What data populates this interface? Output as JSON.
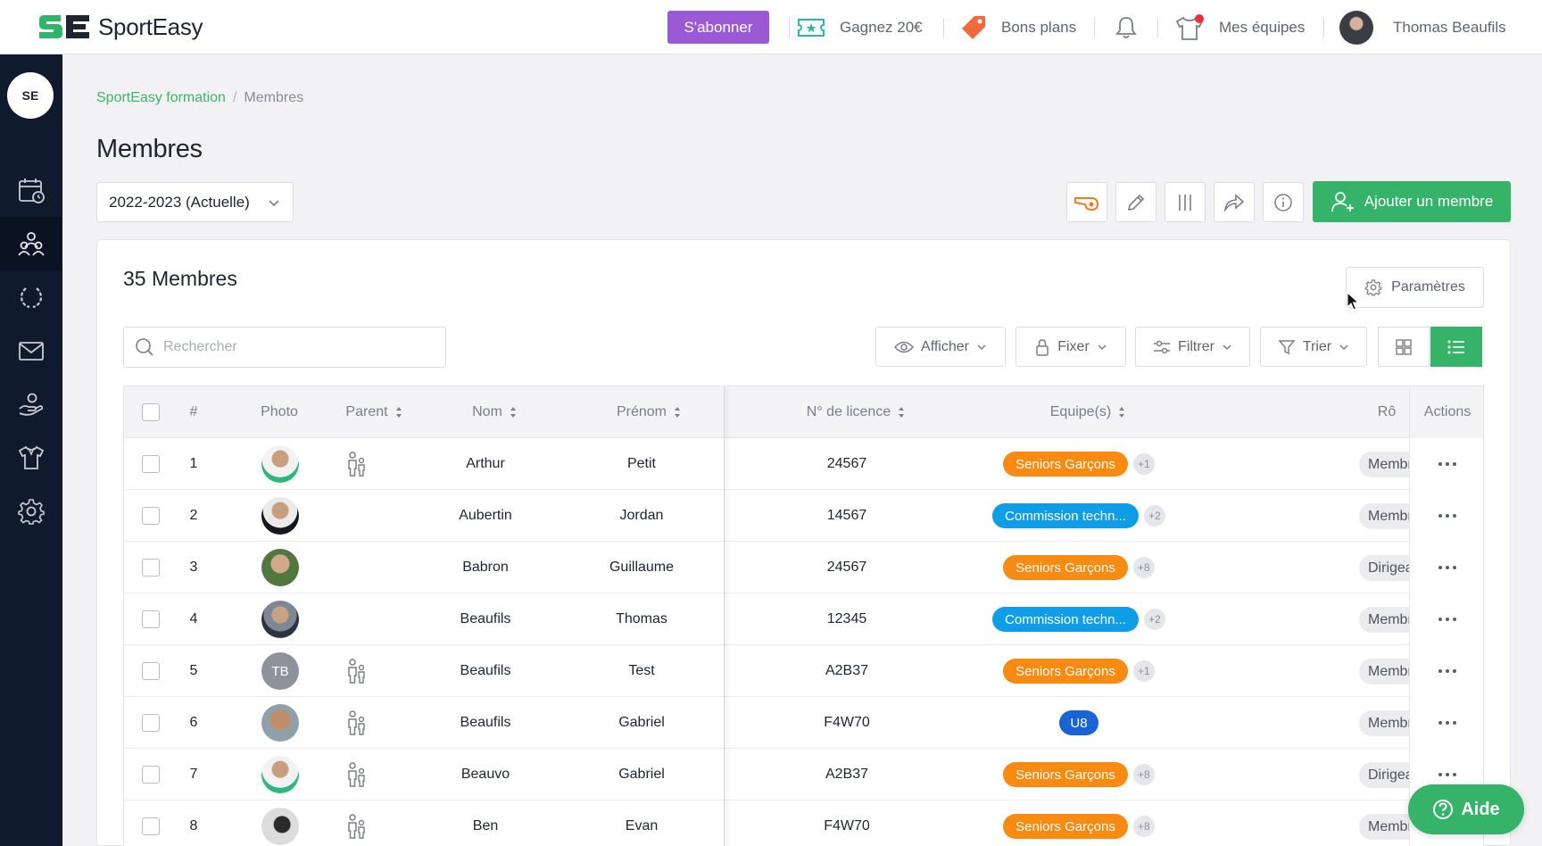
{
  "app": {
    "name": "SportEasy"
  },
  "topbar": {
    "subscribe": "S'abonner",
    "earn": "Gagnez 20€",
    "deals": "Bons plans",
    "my_teams": "Mes équipes",
    "user_name": "Thomas Beaufils"
  },
  "sidebar": {
    "logo_text": "SE"
  },
  "breadcrumb": {
    "parent": "SportEasy formation",
    "sep": "/",
    "current": "Membres"
  },
  "page": {
    "title": "Membres",
    "season": "2022-2023 (Actuelle)",
    "add_member": "Ajouter un membre"
  },
  "panel": {
    "count": "35 Membres",
    "params": "Paramètres",
    "search_placeholder": "Rechercher"
  },
  "filters": {
    "show": "Afficher",
    "pin": "Fixer",
    "filter": "Filtrer",
    "sort": "Trier"
  },
  "table": {
    "headers": {
      "num": "#",
      "photo": "Photo",
      "parent": "Parent",
      "last": "Nom",
      "first": "Prénom",
      "license": "N° de licence",
      "teams": "Equipe(s)",
      "role": "Rô",
      "actions": "Actions"
    },
    "rows": [
      {
        "num": "1",
        "photo": "photo-green",
        "initials": "",
        "parent": true,
        "last": "Arthur",
        "first": "Petit",
        "license": "24567",
        "team": "Seniors Garçons",
        "team_color": "orange",
        "more": "+1",
        "role": "Membre"
      },
      {
        "num": "2",
        "photo": "photo-dark",
        "initials": "",
        "parent": false,
        "last": "Aubertin",
        "first": "Jordan",
        "license": "14567",
        "team": "Commission techn...",
        "team_color": "blue",
        "more": "+2",
        "role": "Membre"
      },
      {
        "num": "3",
        "photo": "photo-outdoor",
        "initials": "",
        "parent": false,
        "last": "Babron",
        "first": "Guillaume",
        "license": "24567",
        "team": "Seniors Garçons",
        "team_color": "orange",
        "more": "+8",
        "role": "Dirigeant"
      },
      {
        "num": "4",
        "photo": "photo-suit",
        "initials": "",
        "parent": false,
        "last": "Beaufils",
        "first": "Thomas",
        "license": "12345",
        "team": "Commission techn...",
        "team_color": "blue",
        "more": "+2",
        "role": "Membre"
      },
      {
        "num": "5",
        "photo": "photo-initials",
        "initials": "TB",
        "parent": true,
        "last": "Beaufils",
        "first": "Test",
        "license": "A2B37",
        "team": "Seniors Garçons",
        "team_color": "orange",
        "more": "+1",
        "role": "Membre"
      },
      {
        "num": "6",
        "photo": "photo-sun",
        "initials": "",
        "parent": true,
        "last": "Beaufils",
        "first": "Gabriel",
        "license": "F4W70",
        "team": "U8",
        "team_color": "navy",
        "more": "",
        "role": "Membre"
      },
      {
        "num": "7",
        "photo": "photo-green",
        "initials": "",
        "parent": true,
        "last": "Beauvo",
        "first": "Gabriel",
        "license": "A2B37",
        "team": "Seniors Garçons",
        "team_color": "orange",
        "more": "+8",
        "role": "Dirigeant"
      },
      {
        "num": "8",
        "photo": "photo-bw",
        "initials": "",
        "parent": true,
        "last": "Ben",
        "first": "Evan",
        "license": "F4W70",
        "team": "Seniors Garçons",
        "team_color": "orange",
        "more": "+8",
        "role": "Membre"
      }
    ]
  },
  "help": {
    "label": "Aide"
  },
  "colors": {
    "accent_green": "#34b369",
    "subscribe_purple": "#9b59d6",
    "sidebar_bg": "#0f1a2c",
    "team_orange": "#f98a12",
    "team_blue": "#0f9de8",
    "team_navy": "#1b62d6"
  }
}
